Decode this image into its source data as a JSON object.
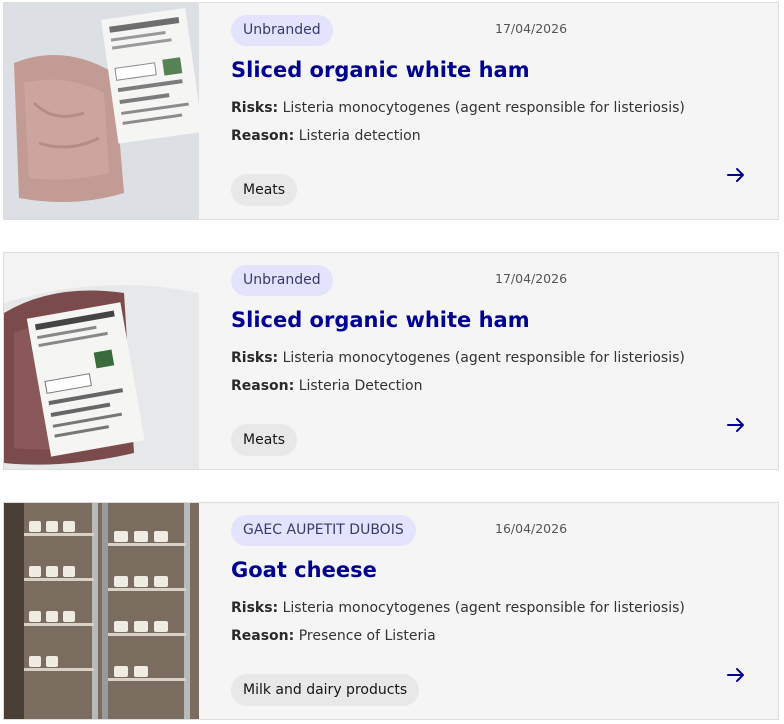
{
  "colors": {
    "title": "#000091",
    "brand_badge_bg": "#e3e3fd",
    "tag_bg": "#e8e8e8",
    "card_bg": "#f5f5f5",
    "arrow": "#000091"
  },
  "recalls": [
    {
      "brand": "Unbranded",
      "date": "17/04/2026",
      "title": "Sliced organic white ham",
      "risks_label": "Risks:",
      "risks": "Listeria monocytogenes (agent responsible for listeriosis)",
      "reason_label": "Reason:",
      "reason": "Listeria detection",
      "category": "Meats",
      "image_icon": "ham-package-photo",
      "arrow_icon": "arrow-right-icon"
    },
    {
      "brand": "Unbranded",
      "date": "17/04/2026",
      "title": "Sliced organic white ham",
      "risks_label": "Risks:",
      "risks": "Listeria monocytogenes (agent responsible for listeriosis)",
      "reason_label": "Reason:",
      "reason": "Listeria Detection",
      "category": "Meats",
      "image_icon": "ham-package-photo",
      "arrow_icon": "arrow-right-icon"
    },
    {
      "brand": "GAEC AUPETIT DUBOIS",
      "date": "16/04/2026",
      "title": "Goat cheese",
      "risks_label": "Risks:",
      "risks": "Listeria monocytogenes (agent responsible for listeriosis)",
      "reason_label": "Reason:",
      "reason": "Presence of Listeria",
      "category": "Milk and dairy products",
      "image_icon": "cheese-rack-photo",
      "arrow_icon": "arrow-right-icon"
    }
  ]
}
